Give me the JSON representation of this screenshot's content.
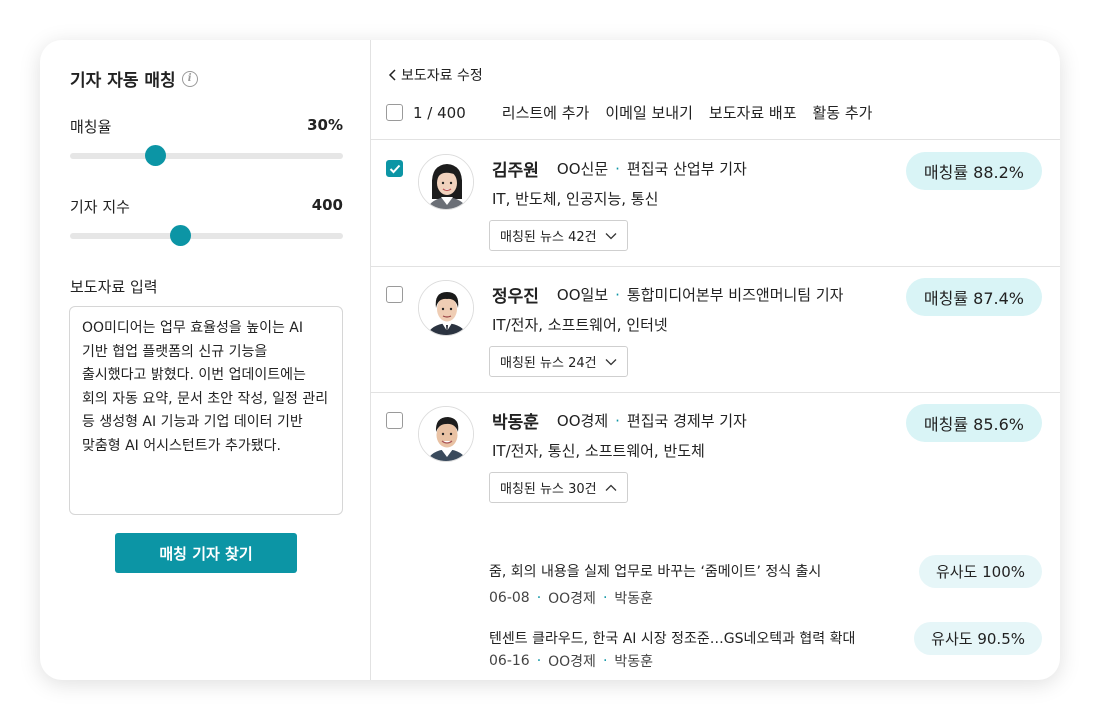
{
  "left": {
    "title": "기자 자동 매칭",
    "match_rate": {
      "label": "매칭율",
      "value": "30%",
      "level": 0.3
    },
    "reporter_index": {
      "label": "기자 지수",
      "value": "400",
      "level": 0.41
    },
    "press_input_label": "보도자료 입력",
    "press_text": "OO미디어는 업무 효율성을 높이는 AI 기반 협업 플랫폼의 신규 기능을 출시했다고 밝혔다. 이번 업데이트에는 회의 자동 요약, 문서 초안 작성, 일정 관리 등 생성형 AI 기능과 기업 데이터 기반 맞춤형 AI 어시스턴트가 추가됐다.",
    "find_button": "매칭 기자 찾기"
  },
  "right": {
    "back_label": "보도자료 수정",
    "selection_count": "1 / 400",
    "actions": [
      "리스트에 추가",
      "이메일 보내기",
      "보도자료 배포",
      "활동 추가"
    ],
    "reporters": [
      {
        "name": "김주원",
        "outlet": "OO신문",
        "position": "편집국 산업부 기자",
        "beat": "IT, 반도체, 인공지능, 통신",
        "news_count": "매칭된 뉴스 42건",
        "score": "매칭률 88.2%",
        "checked": true,
        "expanded": false
      },
      {
        "name": "정우진",
        "outlet": "OO일보",
        "position": "통합미디어본부 비즈앤머니팀 기자",
        "beat": "IT/전자, 소프트웨어, 인터넷",
        "news_count": "매칭된 뉴스 24건",
        "score": "매칭률 87.4%",
        "checked": false,
        "expanded": false
      },
      {
        "name": "박동훈",
        "outlet": "OO경제",
        "position": "편집국 경제부 기자",
        "beat": "IT/전자, 통신, 소프트웨어, 반도체",
        "news_count": "매칭된 뉴스 30건",
        "score": "매칭률 85.6%",
        "checked": false,
        "expanded": true,
        "articles": [
          {
            "title": "줌, 회의 내용을 실제 업무로 바꾸는 ‘줌메이트’ 정식 출시",
            "date": "06-08",
            "outlet": "OO경제",
            "author": "박동훈",
            "similarity": "유사도 100%"
          },
          {
            "title": "텐센트 클라우드, 한국 AI 시장 정조준…GS네오텍과 협력 확대",
            "date": "06-16",
            "outlet": "OO경제",
            "author": "박동훈",
            "similarity": "유사도 90.5%"
          }
        ]
      }
    ]
  },
  "colors": {
    "accent": "#0c95a5",
    "badge_bg": "#d9f4f6"
  }
}
